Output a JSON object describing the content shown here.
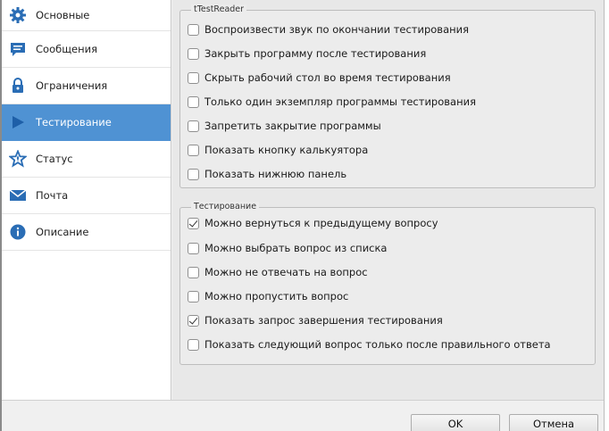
{
  "sidebar": {
    "items": [
      {
        "label": "Основные",
        "icon": "gear-icon"
      },
      {
        "label": "Сообщения",
        "icon": "message-icon"
      },
      {
        "label": "Ограничения",
        "icon": "lock-icon"
      },
      {
        "label": "Тестирование",
        "icon": "play-icon"
      },
      {
        "label": "Статус",
        "icon": "star-icon"
      },
      {
        "label": "Почта",
        "icon": "mail-icon"
      },
      {
        "label": "Описание",
        "icon": "info-icon"
      }
    ],
    "active_index": 3
  },
  "treader_group": {
    "legend": "tTestReader",
    "options": [
      {
        "label": "Воспроизвести звук по окончании тестирования",
        "checked": false
      },
      {
        "label": "Закрыть программу после тестирования",
        "checked": false
      },
      {
        "label": "Скрыть рабочий стол во время тестирования",
        "checked": false
      },
      {
        "label": "Только один экземпляр программы тестирования",
        "checked": false
      },
      {
        "label": "Запретить закрытие программы",
        "checked": false
      },
      {
        "label": "Показать кнопку калькуятора",
        "checked": false
      },
      {
        "label": "Показать нижнюю панель",
        "checked": false
      }
    ]
  },
  "testing_group": {
    "legend": "Тестирование",
    "options": [
      {
        "label": "Можно вернуться к предыдущему вопросу",
        "checked": true
      },
      {
        "label": "Можно выбрать вопрос из списка",
        "checked": false
      },
      {
        "label": "Можно не отвечать на вопрос",
        "checked": false
      },
      {
        "label": "Можно пропустить вопрос",
        "checked": false
      },
      {
        "label": "Показать запрос завершения тестирования",
        "checked": true
      },
      {
        "label": "Показать следующий вопрос только после правильного ответа",
        "checked": false
      }
    ]
  },
  "footer": {
    "ok_label": "OK",
    "cancel_label": "Отмена"
  },
  "colors": {
    "accent": "#4f92d3",
    "icon_blue": "#2a6db5"
  }
}
